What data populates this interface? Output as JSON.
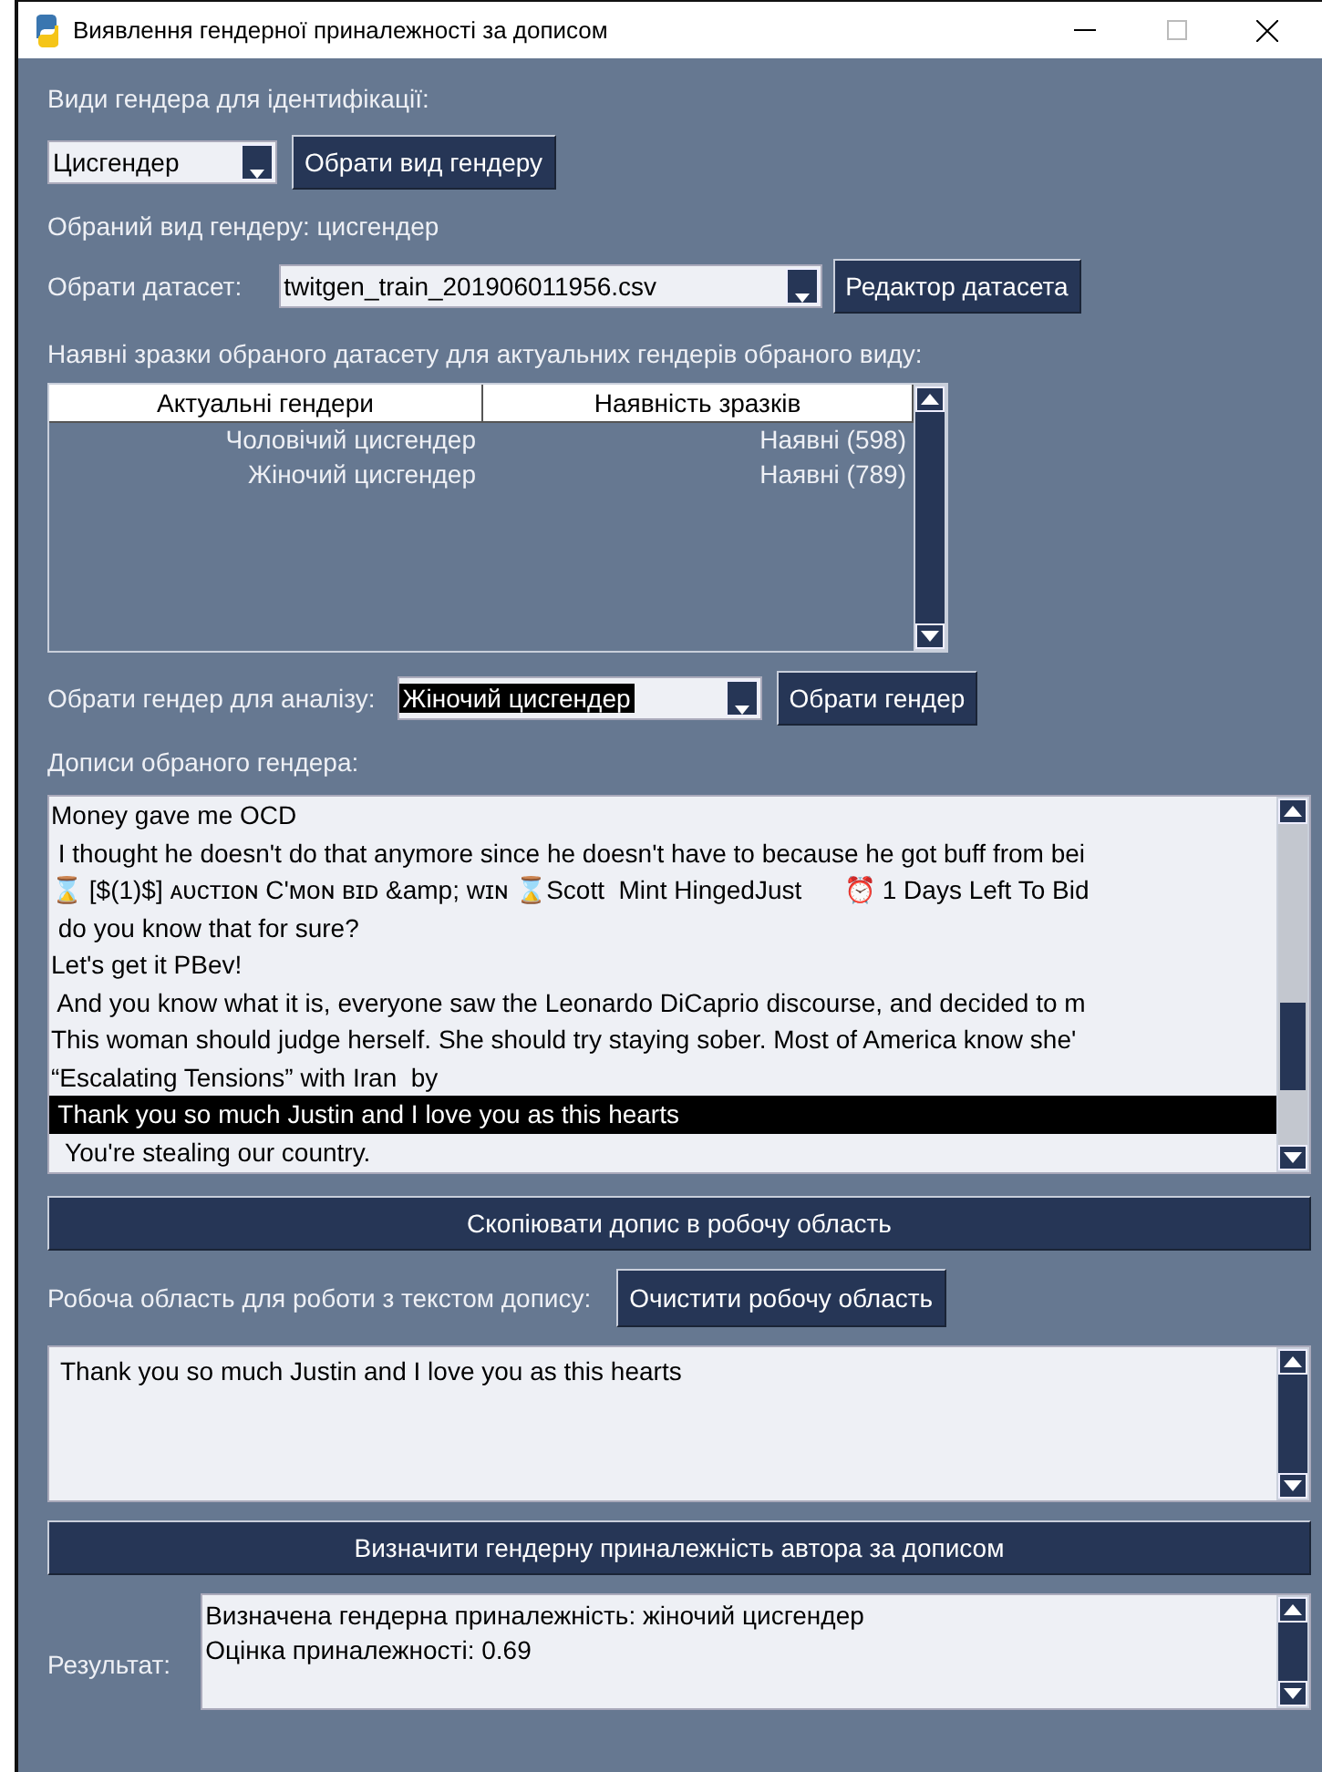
{
  "window": {
    "title": "Виявлення гендерної приналежності за дописом"
  },
  "gender_types": {
    "label": "Види гендера для ідентифікації:",
    "value": "Цисгендер",
    "button": "Обрати вид гендеру"
  },
  "selected_type": "Обраний вид гендеру: цисгендер",
  "dataset": {
    "label": "Обрати датасет:",
    "value": "twitgen_train_201906011956.csv",
    "button": "Редактор датасета"
  },
  "samples": {
    "label": "Наявні зразки обраного датасету для актуальних гендерів обраного виду:",
    "columns": [
      "Актуальні гендери",
      "Наявність зразків"
    ],
    "rows": [
      [
        "Чоловічий цисгендер",
        "Наявні (598)"
      ],
      [
        "Жіночий цисгендер",
        "Наявні (789)"
      ]
    ]
  },
  "analysis": {
    "label": "Обрати гендер для аналізу:",
    "value": "Жіночий цисгендер",
    "button": "Обрати гендер"
  },
  "posts": {
    "label": "Дописи обраного гендера:",
    "items": [
      {
        "text": "Money gave me OCD",
        "selected": false
      },
      {
        "text": " I thought he doesn't do that anymore since he doesn't have to because he got buff from bei",
        "selected": false
      },
      {
        "text": "⌛ [$(1)$] ᴀᴜᴄᴛɪᴏɴ C'ᴍᴏɴ ʙɪᴅ &amp; ᴡɪɴ ⌛Scott  Mint HingedJust      ⏰ 1 Days Left To Bid",
        "selected": false
      },
      {
        "text": " do you know that for sure?",
        "selected": false
      },
      {
        "text": "Let's get it PBev!",
        "selected": false
      },
      {
        "text": " And you know what it is, everyone saw the Leonardo DiCaprio discourse, and decided to m",
        "selected": false
      },
      {
        "text": "This woman should judge herself. She should try staying sober. Most of America know she'",
        "selected": false
      },
      {
        "text": "“Escalating Tensions” with Iran  by",
        "selected": false
      },
      {
        "text": " Thank you so much Justin and I love you as this hearts",
        "selected": true
      },
      {
        "text": "  You're stealing our country.",
        "selected": false
      }
    ]
  },
  "copy_button": "Скопіювати допис в робочу область",
  "workspace": {
    "label": "Робоча область для роботи з текстом допису:",
    "button": "Очистити робочу область",
    "text": "Thank you so much Justin and I love you as this hearts"
  },
  "determine_button": "Визначити гендерну приналежність автора за дописом",
  "result": {
    "label": "Результат:",
    "lines": [
      "Визначена гендерна приналежність: жіночий цисгендер",
      "Оцінка приналежності: 0.69"
    ]
  }
}
